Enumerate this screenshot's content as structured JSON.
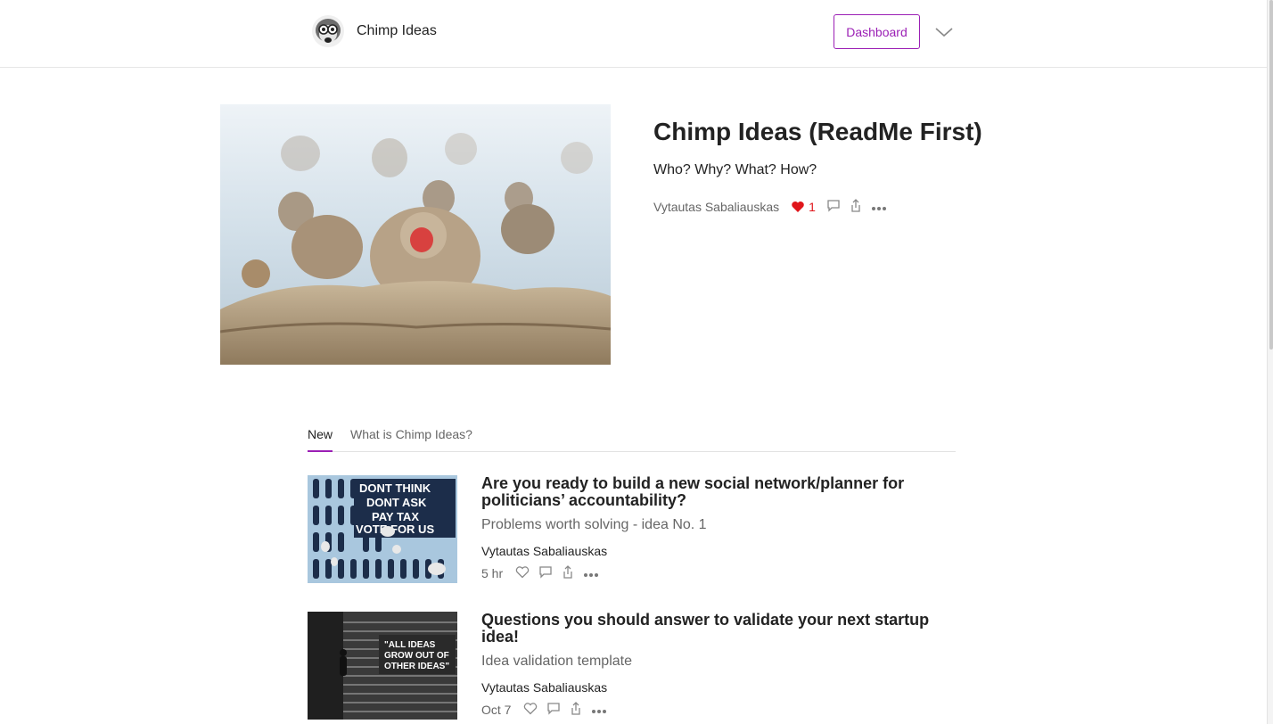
{
  "header": {
    "brand": "Chimp Ideas",
    "dashboard_label": "Dashboard"
  },
  "featured": {
    "title": "Chimp Ideas (ReadMe First)",
    "subtitle": "Who? Why? What? How?",
    "author": "Vytautas Sabaliauskas",
    "likes": "1"
  },
  "tabs": [
    {
      "label": "New",
      "active": true
    },
    {
      "label": "What is Chimp Ideas?",
      "active": false
    }
  ],
  "posts": [
    {
      "title": "Are you ready to build a new social network/planner for politicians’ accountability?",
      "subtitle": "Problems worth solving - idea No. 1",
      "author": "Vytautas Sabaliauskas",
      "date": "5 hr",
      "image_text": [
        "DONT THINK",
        "DONT ASK",
        "PAY TAX",
        "VOTE FOR US"
      ]
    },
    {
      "title": "Questions you should answer to validate your next startup idea!",
      "subtitle": "Idea validation template",
      "author": "Vytautas Sabaliauskas",
      "date": "Oct 7",
      "image_text": [
        "\"ALL IDEAS",
        "GROW OUT OF",
        "OTHER IDEAS\""
      ]
    }
  ],
  "colors": {
    "accent": "#9b1fb5",
    "heart": "#e0161b",
    "muted_text": "#666666",
    "poster_bg": "#a9c7de"
  },
  "icons": [
    "chimp-logo-icon",
    "chevron-down-icon",
    "heart-icon",
    "comment-icon",
    "share-icon",
    "more-icon"
  ]
}
